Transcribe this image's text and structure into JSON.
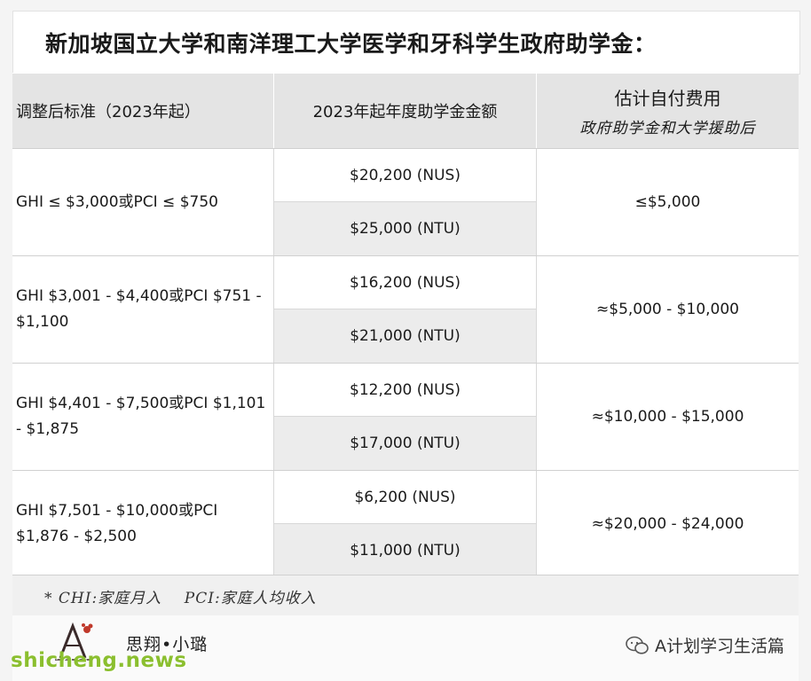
{
  "title": "新加坡国立大学和南洋理工大学医学和牙科学生政府助学金：",
  "headers": {
    "criteria": "调整后标准（2023年起）",
    "amount": "2023年起年度助学金金额",
    "estimated_main": "估计自付费用",
    "estimated_sub": "政府助学金和大学援助后"
  },
  "rows": [
    {
      "criteria": "GHI ≤ $3,000或PCI ≤ $750",
      "nus": "$20,200 (NUS)",
      "ntu": "$25,000 (NTU)",
      "estimate": "≤$5,000"
    },
    {
      "criteria": "GHI $3,001 - $4,400或PCI $751 - $1,100",
      "nus": "$16,200 (NUS)",
      "ntu": "$21,000 (NTU)",
      "estimate": "≈$5,000 - $10,000"
    },
    {
      "criteria": "GHI $4,401 - $7,500或PCI $1,101 - $1,875",
      "nus": "$12,200 (NUS)",
      "ntu": "$17,000 (NTU)",
      "estimate": "≈$10,000 - $15,000"
    },
    {
      "criteria": "GHI $7,501 - $10,000或PCI $1,876 - $2,500",
      "nus": "$6,200 (NUS)",
      "ntu": "$11,000 (NTU)",
      "estimate": "≈$20,000 - $24,000"
    }
  ],
  "footnote": "* CHI:家庭月入    PCI:家庭人均收入",
  "author": "思翔•小璐",
  "wechat_account": "A计划学习生活篇",
  "watermark": "shicheng.news",
  "icons": {
    "logo": "author-logo-icon",
    "wechat": "wechat-icon"
  },
  "colors": {
    "watermark": "#8bbf2f",
    "header_bg": "#e4e4e4",
    "alt_cell_bg": "#ececec"
  }
}
